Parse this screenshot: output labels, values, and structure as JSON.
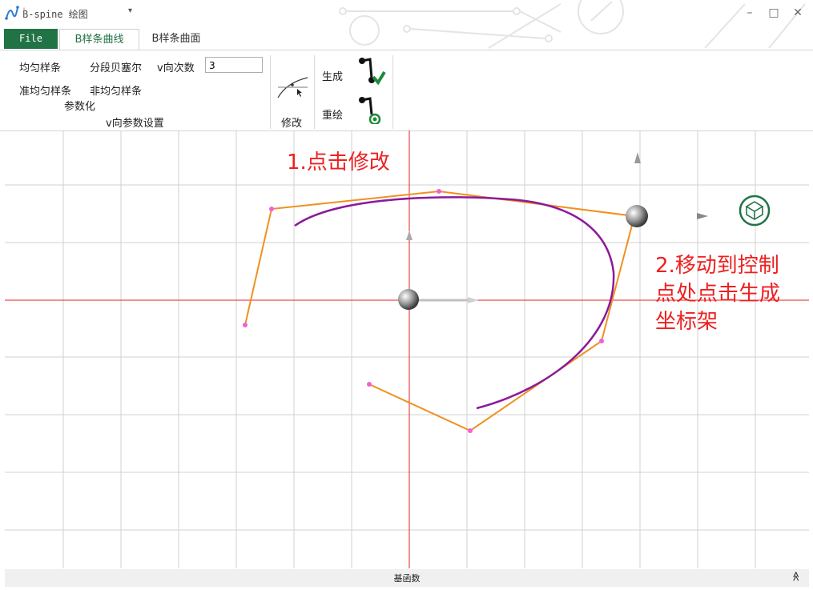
{
  "app": {
    "title": "B-spine 绘图",
    "quick_access_arrow": "▾",
    "window_controls": {
      "minimize": "–",
      "maximize": "□",
      "close": "✕"
    }
  },
  "tabs": {
    "file": "File",
    "curve": "B样条曲线",
    "surface": "B样条曲面"
  },
  "ribbon": {
    "parametrization": {
      "uniform": "均匀样条",
      "piecewise_bezier": "分段贝塞尔",
      "quasi_uniform": "准均匀样条",
      "non_uniform": "非均匀样条",
      "group_label": "参数化"
    },
    "v_settings": {
      "degree_label": "v向次数",
      "degree_value": "3",
      "group_label": "v向参数设置"
    },
    "modify_label": "修改",
    "generate_label": "生成",
    "redraw_label": "重绘"
  },
  "annotations": {
    "step1": "1.点击修改",
    "step2_line1": "2.移动到控制",
    "step2_line2": "点处点击生成",
    "step2_line3": "坐标架"
  },
  "statusbar": {
    "label": "基函数",
    "chevron": "≫"
  },
  "colors": {
    "accent_green": "#217346",
    "control_polygon": "#f0901e",
    "control_point": "#f060d8",
    "curve": "#8b1a9a",
    "axis_red": "#e02020",
    "grid": "#d0d0d0",
    "annotation_red": "#ee2020"
  }
}
